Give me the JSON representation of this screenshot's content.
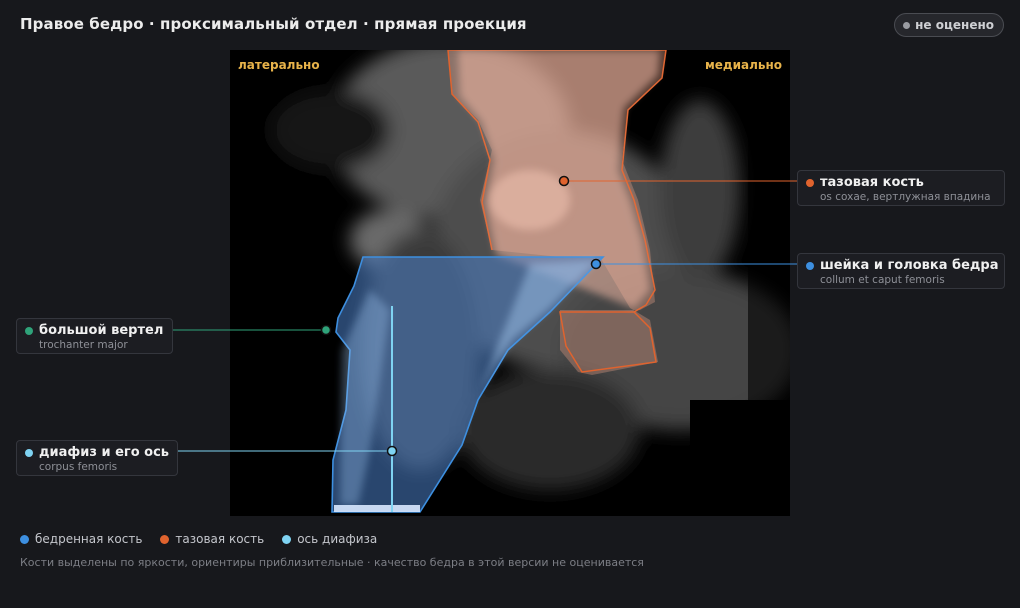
{
  "header": {
    "title": "Правое бедро · проксимальный отдел · прямая проекция",
    "status_badge": "не оценено"
  },
  "viewer": {
    "label_lateral": "латерально",
    "label_medial": "медиально"
  },
  "landmarks": [
    {
      "id": "pelvis",
      "name": "тазовая кость",
      "latin": "os coxae, вертлужная впадина",
      "color": "#e0632e"
    },
    {
      "id": "neck",
      "name": "шейка и головка бедра",
      "latin": "collum et caput femoris",
      "color": "#3d8fe0"
    },
    {
      "id": "trochanter",
      "name": "большой вертел",
      "latin": "trochanter major",
      "color": "#2fa37a"
    },
    {
      "id": "shaft",
      "name": "диафиз и его ось",
      "latin": "corpus femoris",
      "color": "#7fd3f2"
    }
  ],
  "legend": [
    {
      "label": "бедренная кость",
      "color": "#3d8fe0"
    },
    {
      "label": "тазовая кость",
      "color": "#e0632e"
    },
    {
      "label": "ось диафиза",
      "color": "#7fd3f2"
    }
  ],
  "footnote": "Кости выделены по яркости, ориентиры приблизительные · качество бедра в этой версии не оценивается"
}
